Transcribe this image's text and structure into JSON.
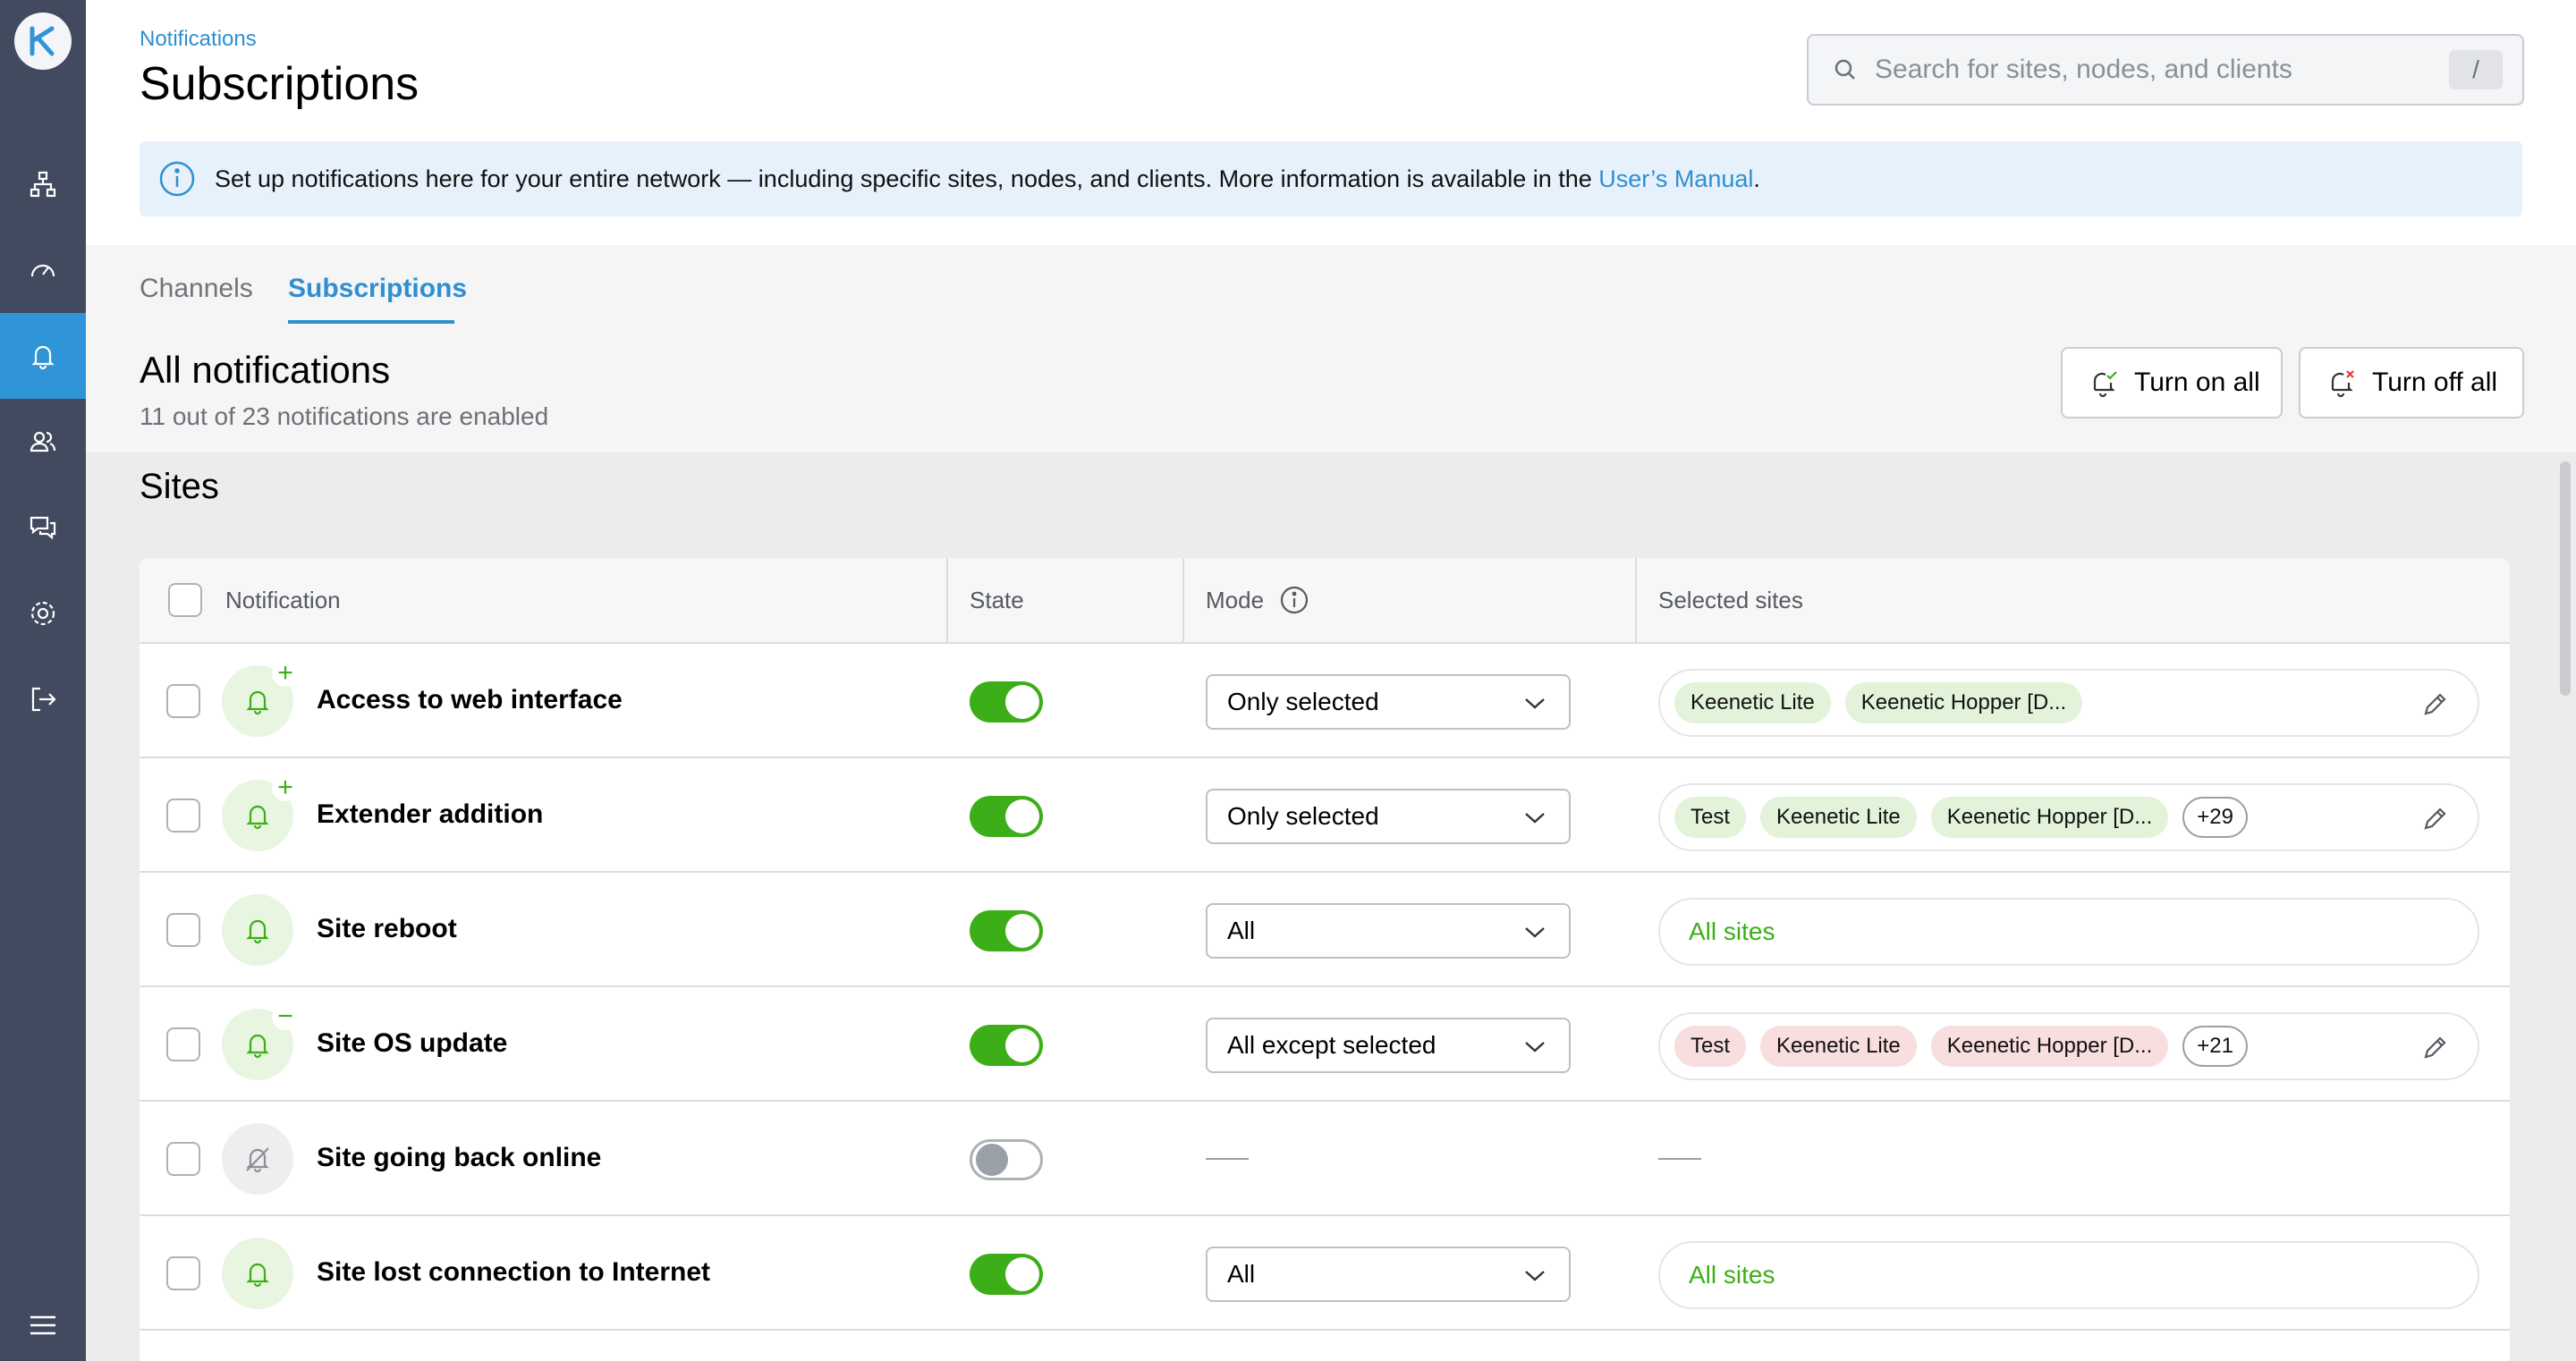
{
  "colors": {
    "sidebar": "#414a5e",
    "accent": "#2f95d8",
    "enabled": "#3cae17"
  },
  "sidebar": {
    "items": [
      {
        "icon": "network-topology-icon"
      },
      {
        "icon": "dashboard-gauge-icon"
      },
      {
        "icon": "bell-icon",
        "active": true
      },
      {
        "icon": "users-icon"
      },
      {
        "icon": "chat-icon"
      },
      {
        "icon": "gear-icon"
      },
      {
        "icon": "logout-icon"
      },
      {
        "icon": "menu-icon"
      }
    ]
  },
  "header": {
    "breadcrumb": "Notifications",
    "title": "Subscriptions",
    "search_placeholder": "Search for sites, nodes, and clients",
    "search_shortcut": "/"
  },
  "banner": {
    "text": "Set up notifications here for your entire network — including specific sites, nodes, and clients. More information is available in the ",
    "link": "User’s Manual",
    "end": "."
  },
  "tabs": {
    "channels": "Channels",
    "subscriptions": "Subscriptions"
  },
  "section": {
    "title": "All notifications",
    "subtitle": "11 out of 23 notifications are enabled",
    "turn_on_all": "Turn on all",
    "turn_off_all": "Turn off all"
  },
  "sites": {
    "title": "Sites",
    "columns": {
      "notification": "Notification",
      "state": "State",
      "mode": "Mode",
      "selected": "Selected sites"
    },
    "rows": [
      {
        "name": "Access to web interface",
        "enabled": true,
        "badge": "+",
        "mode": "Only selected",
        "chips": [
          "Keenetic Lite",
          "Keenetic Hopper [D..."
        ],
        "chip_color": "green",
        "more": "",
        "all_text": ""
      },
      {
        "name": "Extender addition",
        "enabled": true,
        "badge": "+",
        "mode": "Only selected",
        "chips": [
          "Test",
          "Keenetic Lite",
          "Keenetic Hopper [D..."
        ],
        "chip_color": "green",
        "more": "+29",
        "all_text": ""
      },
      {
        "name": "Site reboot",
        "enabled": true,
        "badge": "",
        "mode": "All",
        "chips": [],
        "chip_color": "green",
        "more": "",
        "all_text": "All sites"
      },
      {
        "name": "Site OS update",
        "enabled": true,
        "badge": "−",
        "mode": "All except selected",
        "chips": [
          "Test",
          "Keenetic Lite",
          "Keenetic Hopper [D..."
        ],
        "chip_color": "red",
        "more": "+21",
        "all_text": ""
      },
      {
        "name": "Site going back online",
        "enabled": false,
        "badge": "",
        "mode": "",
        "chips": [],
        "chip_color": "green",
        "more": "",
        "all_text": ""
      },
      {
        "name": "Site lost connection to Internet",
        "enabled": true,
        "badge": "",
        "mode": "All",
        "chips": [],
        "chip_color": "green",
        "more": "",
        "all_text": "All sites"
      }
    ]
  }
}
